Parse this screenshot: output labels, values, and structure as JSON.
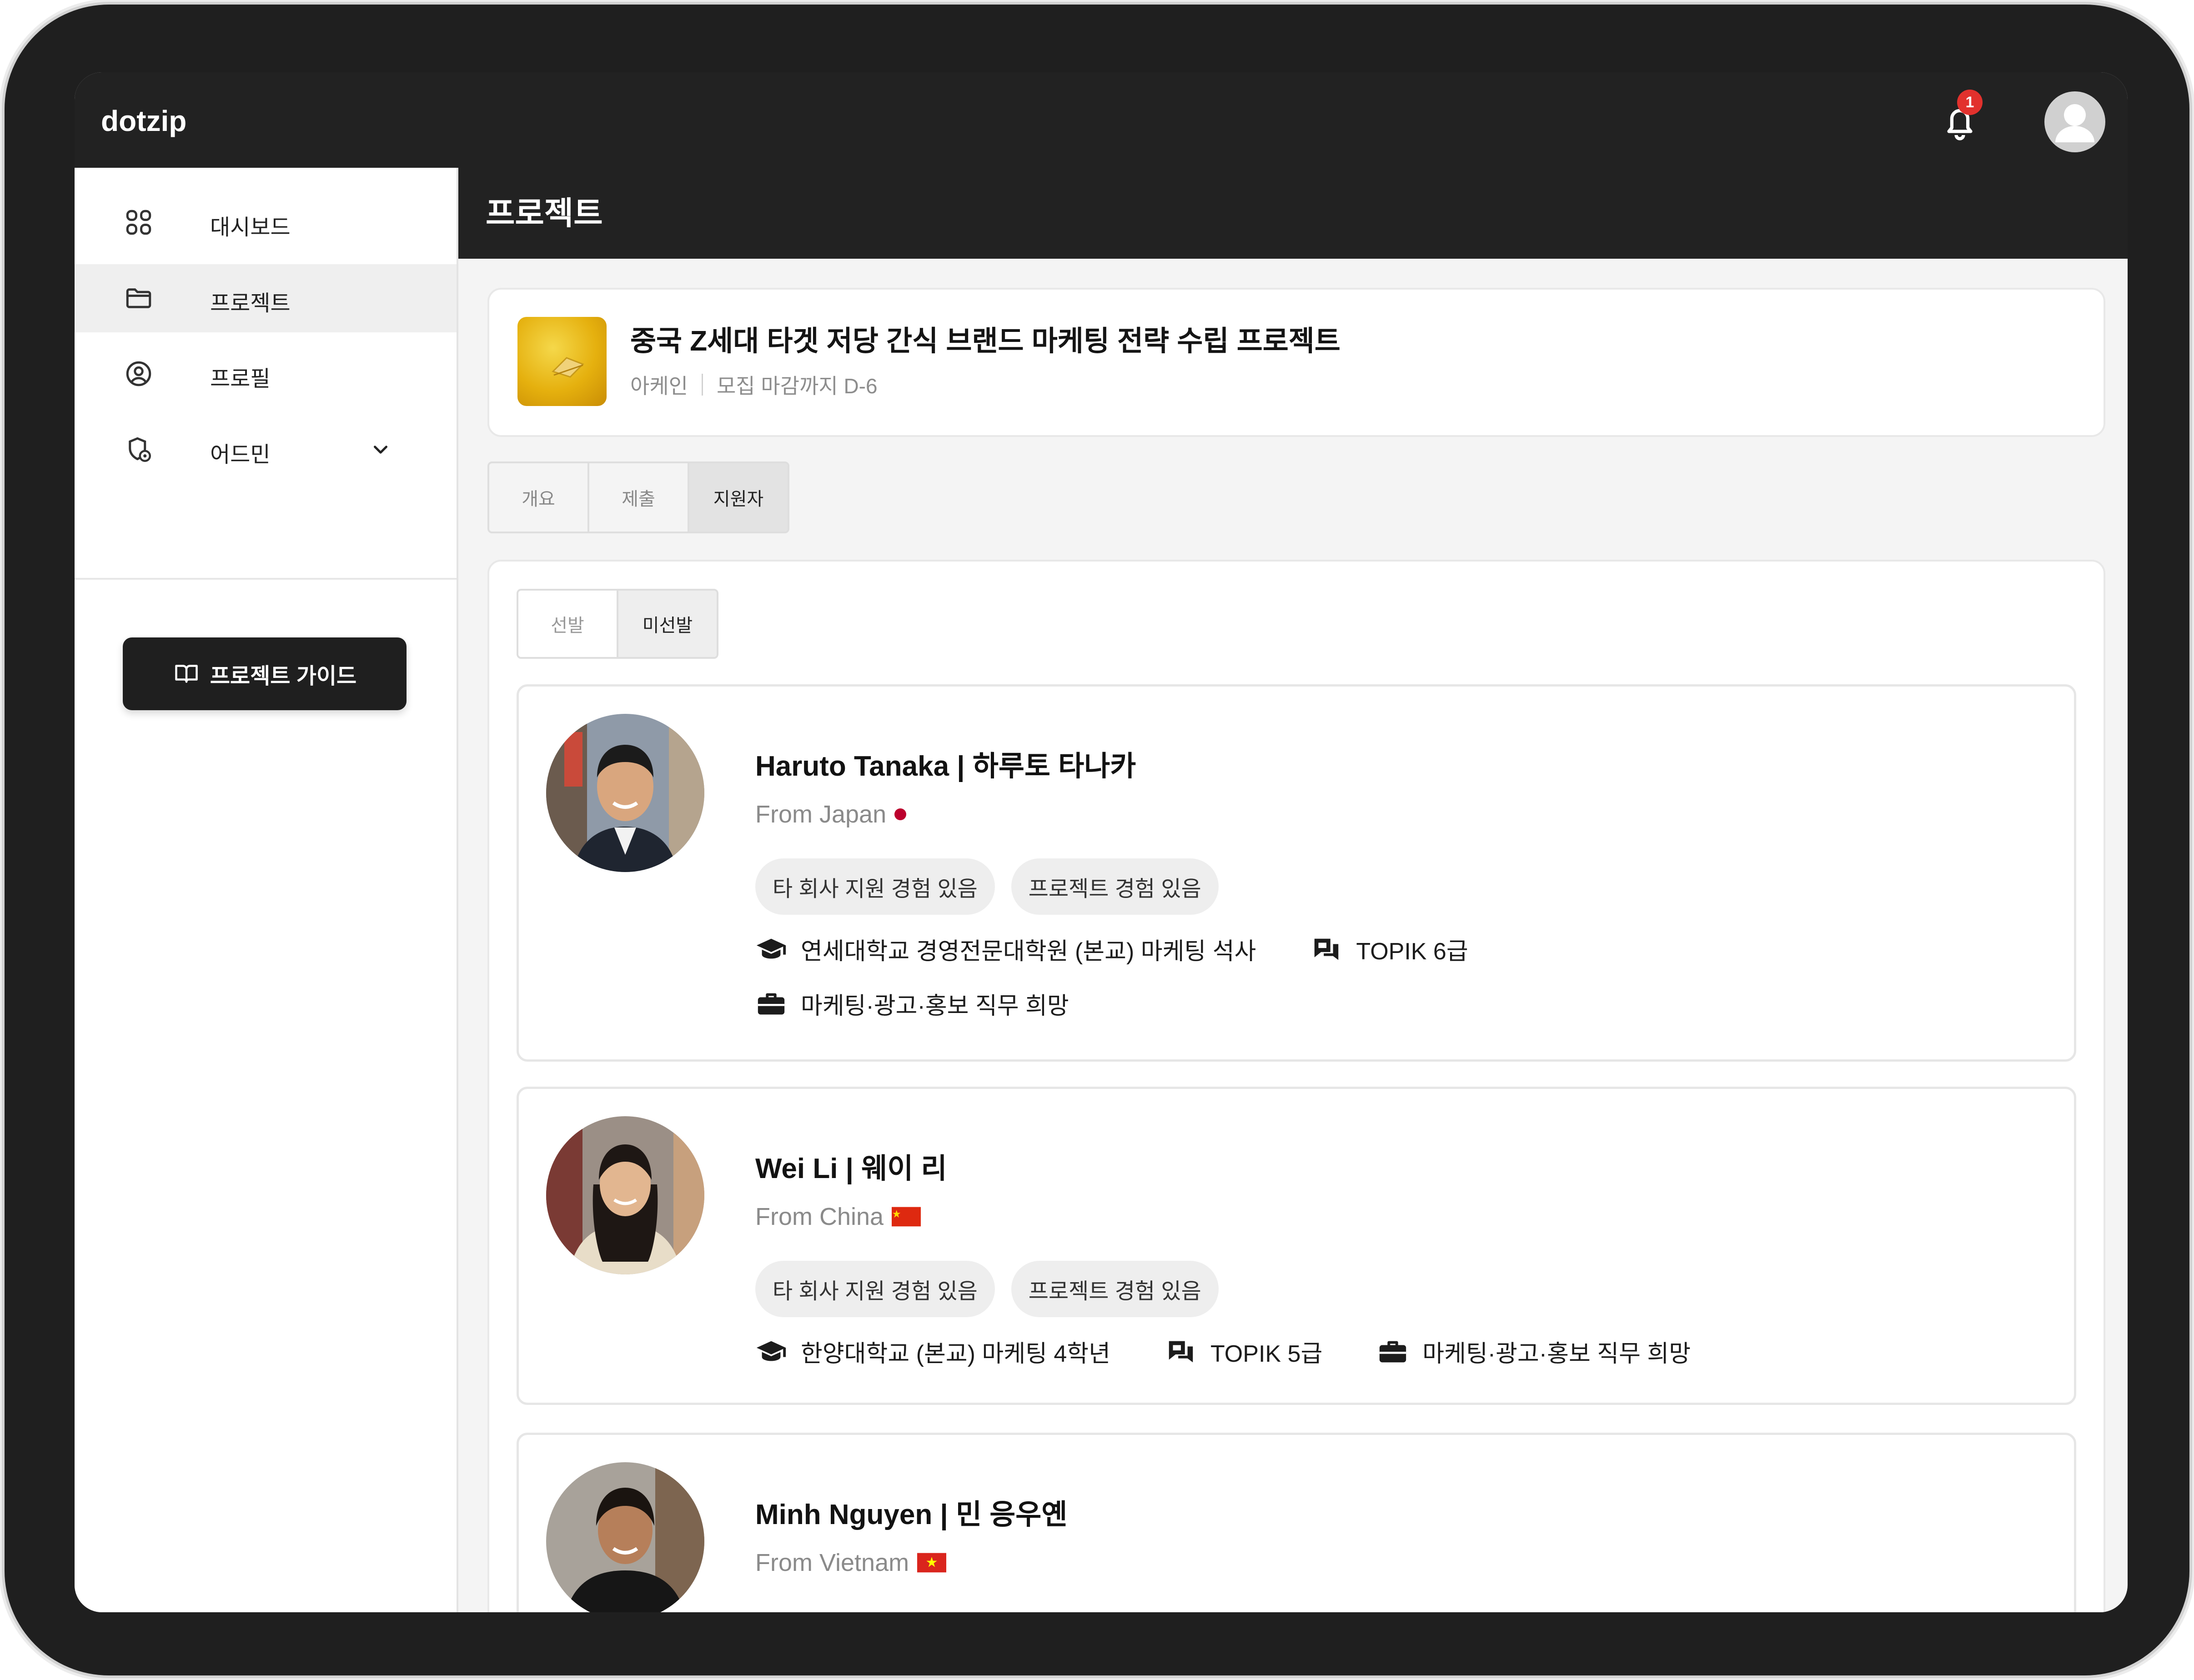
{
  "app": {
    "brand": "dotzip",
    "notification_count": "1"
  },
  "sidebar": {
    "items": [
      {
        "label": "대시보드",
        "icon": "dashboard-grid-icon"
      },
      {
        "label": "프로젝트",
        "icon": "folder-icon"
      },
      {
        "label": "프로필",
        "icon": "user-circle-icon"
      },
      {
        "label": "어드민",
        "icon": "admin-shield-icon"
      }
    ],
    "active": "프로젝트",
    "guide_button": "프로젝트 가이드"
  },
  "main": {
    "title": "프로젝트",
    "project": {
      "title": "중국 Z세대 타겟 저당 간식 브랜드 마케팅 전략 수립 프로젝트",
      "company": "아케인",
      "deadline": "모집 마감까지 D-6"
    },
    "tabs": [
      "개요",
      "제출",
      "지원자"
    ],
    "active_tab": "지원자",
    "subtabs": [
      "선발",
      "미선발"
    ],
    "active_subtab": "미선발"
  },
  "applicants": [
    {
      "name": "Haruto Tanaka | 하루토 타나카",
      "from": "From Japan",
      "chips": [
        "타 회사 지원 경험 있음",
        "프로젝트 경험 있음"
      ],
      "school": "연세대학교 경영전문대학원 (본교) 마케팅 석사",
      "topik": "TOPIK 6급",
      "job": "마케팅·광고·홍보 직무 희망"
    },
    {
      "name": "Wei Li | 웨이 리",
      "from": "From China",
      "chips": [
        "타 회사 지원 경험 있음",
        "프로젝트 경험 있음"
      ],
      "school": "한양대학교 (본교) 마케팅 4학년",
      "topik": "TOPIK 5급",
      "job": "마케팅·광고·홍보 직무 희망"
    },
    {
      "name": "Minh Nguyen | 민 응우옌",
      "from": "From Vietnam"
    }
  ],
  "colors": {
    "accent": "#222222",
    "badge": "#e2312d",
    "chip_bg": "#eeeeee"
  }
}
